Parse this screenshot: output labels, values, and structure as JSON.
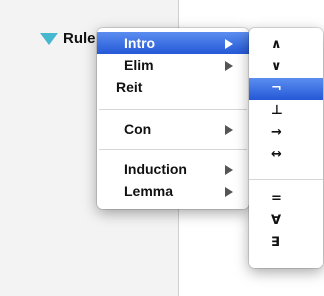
{
  "rules": {
    "label": "Rule"
  },
  "main_menu": {
    "items": [
      {
        "label": "Intro",
        "highlighted": true,
        "submenu": true
      },
      {
        "label": "Elim",
        "highlighted": false,
        "submenu": true
      },
      {
        "label": "Reit",
        "highlighted": false,
        "submenu": false
      },
      {
        "label": "Con",
        "highlighted": false,
        "submenu": true
      },
      {
        "label": "Induction",
        "highlighted": false,
        "submenu": true
      },
      {
        "label": "Lemma",
        "highlighted": false,
        "submenu": true
      }
    ]
  },
  "intro_submenu": {
    "items": [
      {
        "label": "∧",
        "highlighted": false
      },
      {
        "label": "∨",
        "highlighted": false
      },
      {
        "label": "¬",
        "highlighted": true
      },
      {
        "label": "⊥",
        "highlighted": false
      },
      {
        "label": "→",
        "highlighted": false
      },
      {
        "label": "↔",
        "highlighted": false
      },
      {
        "label": "=",
        "highlighted": false
      },
      {
        "label": "∀",
        "highlighted": false
      },
      {
        "label": "∃",
        "highlighted": false
      }
    ]
  },
  "colors": {
    "highlight": "#3b6fe3",
    "disclosure": "#45b7cf"
  }
}
